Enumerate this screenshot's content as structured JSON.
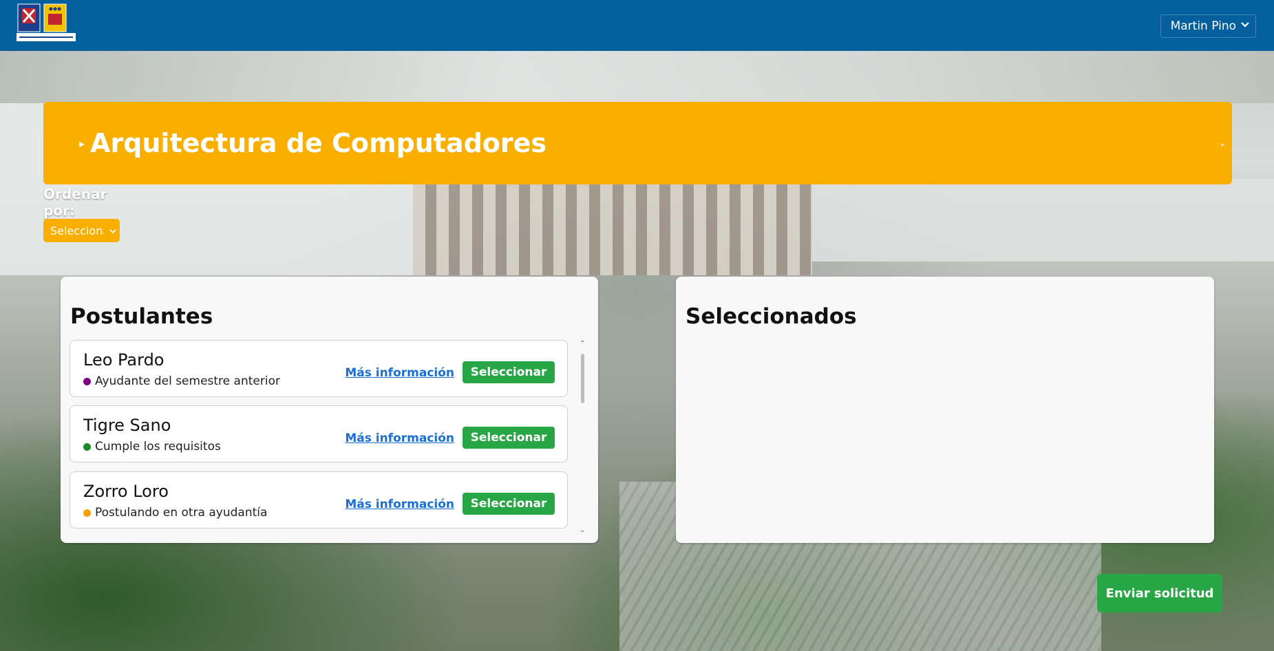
{
  "header": {
    "user_name": "Martin Pino"
  },
  "course": {
    "title": "Arquitectura de Computadores"
  },
  "sort": {
    "label": "Ordenar por:",
    "selected": "Seleccionar"
  },
  "postulantes": {
    "title": "Postulantes",
    "more_label": "Más información",
    "select_label": "Seleccionar",
    "items": [
      {
        "name": "Leo Pardo",
        "status": "Ayudante del semestre anterior",
        "status_color": "#800080"
      },
      {
        "name": "Tigre Sano",
        "status": "Cumple los requisitos",
        "status_color": "#1a8a2a"
      },
      {
        "name": "Zorro Loro",
        "status": "Postulando en otra ayudantía",
        "status_color": "#f5a000"
      }
    ]
  },
  "seleccionados": {
    "title": "Seleccionados"
  },
  "footer": {
    "send_label": "Enviar solicitud"
  },
  "colors": {
    "header_bg": "#04609c",
    "accent_yellow": "#f9af00",
    "green_button": "#28a645",
    "link_blue": "#1a6fd6"
  }
}
